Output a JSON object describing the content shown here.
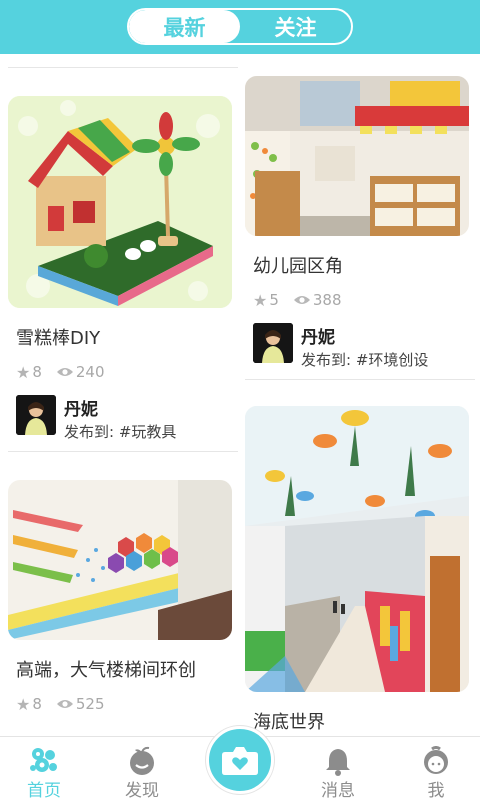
{
  "header": {
    "tabs": [
      {
        "label": "最新",
        "active": true
      },
      {
        "label": "关注",
        "active": false
      }
    ]
  },
  "colors": {
    "accent": "#55d2de",
    "nav_inactive": "#8c8c8c",
    "text_muted": "#a8a8a8"
  },
  "feed": {
    "left": [
      {
        "title": "雪糕棒DIY",
        "stars": "8",
        "views": "240",
        "author": "丹妮",
        "published_to": "发布到: #玩教具"
      },
      {
        "title": "高端，大气楼梯间环创",
        "stars": "8",
        "views": "525"
      }
    ],
    "right": [
      {
        "title": "幼儿园区角",
        "stars": "5",
        "views": "388",
        "author": "丹妮",
        "published_to": "发布到: #环境创设"
      },
      {
        "title": "海底世界"
      }
    ]
  },
  "bottom_nav": {
    "items": [
      {
        "label": "首页",
        "icon": "home-bubbles-icon",
        "active": true
      },
      {
        "label": "发现",
        "icon": "discover-apple-icon",
        "active": false
      },
      {
        "label": "",
        "icon": "camera-heart-icon",
        "active": false
      },
      {
        "label": "消息",
        "icon": "bell-icon",
        "active": false
      },
      {
        "label": "我",
        "icon": "profile-face-icon",
        "active": false
      }
    ]
  }
}
